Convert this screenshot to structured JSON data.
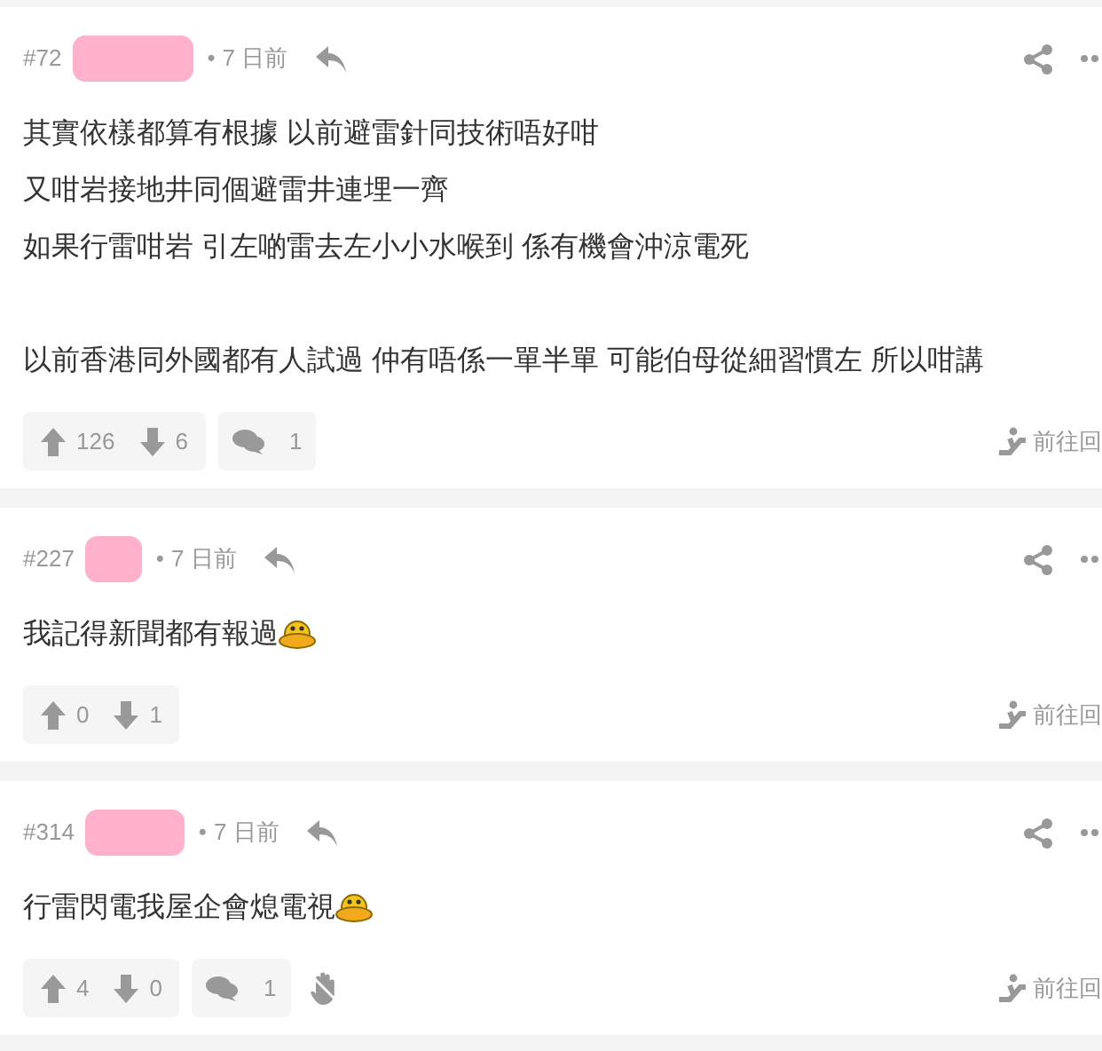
{
  "posts": [
    {
      "number": "#72",
      "separator": "•",
      "time": "7 日前",
      "paragraphs": [
        [
          "其實依樣都算有根據 以前避雷針同技術唔好咁",
          "又咁岩接地井同個避雷井連埋一齊",
          "如果行雷咁岩 引左啲雷去左小小水喉到 係有機會沖涼電死"
        ],
        [
          "以前香港同外國都有人試過 仲有唔係一單半單 可能伯母從細習慣左 所以咁講"
        ]
      ],
      "emoji": false,
      "upvotes": "126",
      "downvotes": "6",
      "comments": "1",
      "hide_icon": false,
      "goto_reply": "前往回"
    },
    {
      "number": "#227",
      "separator": "•",
      "time": "7 日前",
      "paragraphs": [
        [
          "我記得新聞都有報過"
        ]
      ],
      "emoji": true,
      "upvotes": "0",
      "downvotes": "1",
      "hide_icon": false,
      "goto_reply": "前往回"
    },
    {
      "number": "#314",
      "separator": "•",
      "time": "7 日前",
      "paragraphs": [
        [
          "行雷閃電我屋企會熄電視"
        ]
      ],
      "emoji": true,
      "upvotes": "4",
      "downvotes": "0",
      "comments": "1",
      "hide_icon": true,
      "goto_reply": "前往回"
    }
  ]
}
